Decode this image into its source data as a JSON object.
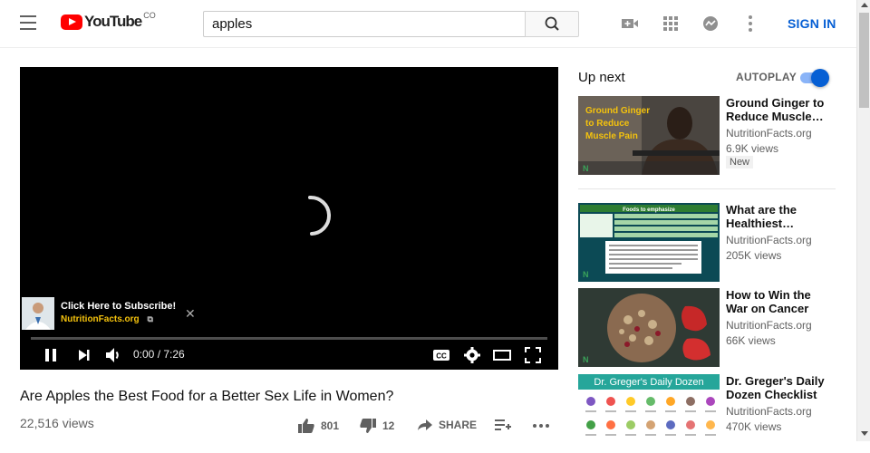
{
  "masthead": {
    "logo_text": "YouTube",
    "logo_country": "CO",
    "search_value": "apples",
    "sign_in": "SIGN IN"
  },
  "player": {
    "subscribe_title": "Click Here to Subscribe!",
    "subscribe_channel": "NutritionFacts.org",
    "time": "0:00 / 7:26"
  },
  "video": {
    "title": "Are Apples the Best Food for a Better Sex Life in Women?",
    "views": "22,516 views",
    "likes": "801",
    "dislikes": "12",
    "share": "SHARE"
  },
  "sidebar": {
    "up_next": "Up next",
    "autoplay": "AUTOPLAY",
    "autoplay_on": true,
    "items": [
      {
        "title": "Ground Ginger to Reduce Muscle…",
        "channel": "NutritionFacts.org",
        "views": "6.9K views",
        "badge": "New",
        "thumb_text": "Ground Ginger to Reduce Muscle Pain"
      },
      {
        "title": "What are the Healthiest…",
        "channel": "NutritionFacts.org",
        "views": "205K views",
        "badge": "",
        "thumb_text": "Foods to emphasize"
      },
      {
        "title": "How to Win the War on Cancer",
        "channel": "NutritionFacts.org",
        "views": "66K views",
        "badge": "",
        "thumb_text": ""
      },
      {
        "title": "Dr. Greger's Daily Dozen Checklist",
        "channel": "NutritionFacts.org",
        "views": "470K views",
        "badge": "",
        "thumb_text": "Dr. Greger's Daily Dozen"
      }
    ]
  },
  "colors": {
    "brand_red": "#ff0000",
    "link_blue": "#065fd4",
    "channel_yellow": "#f4c20d"
  }
}
